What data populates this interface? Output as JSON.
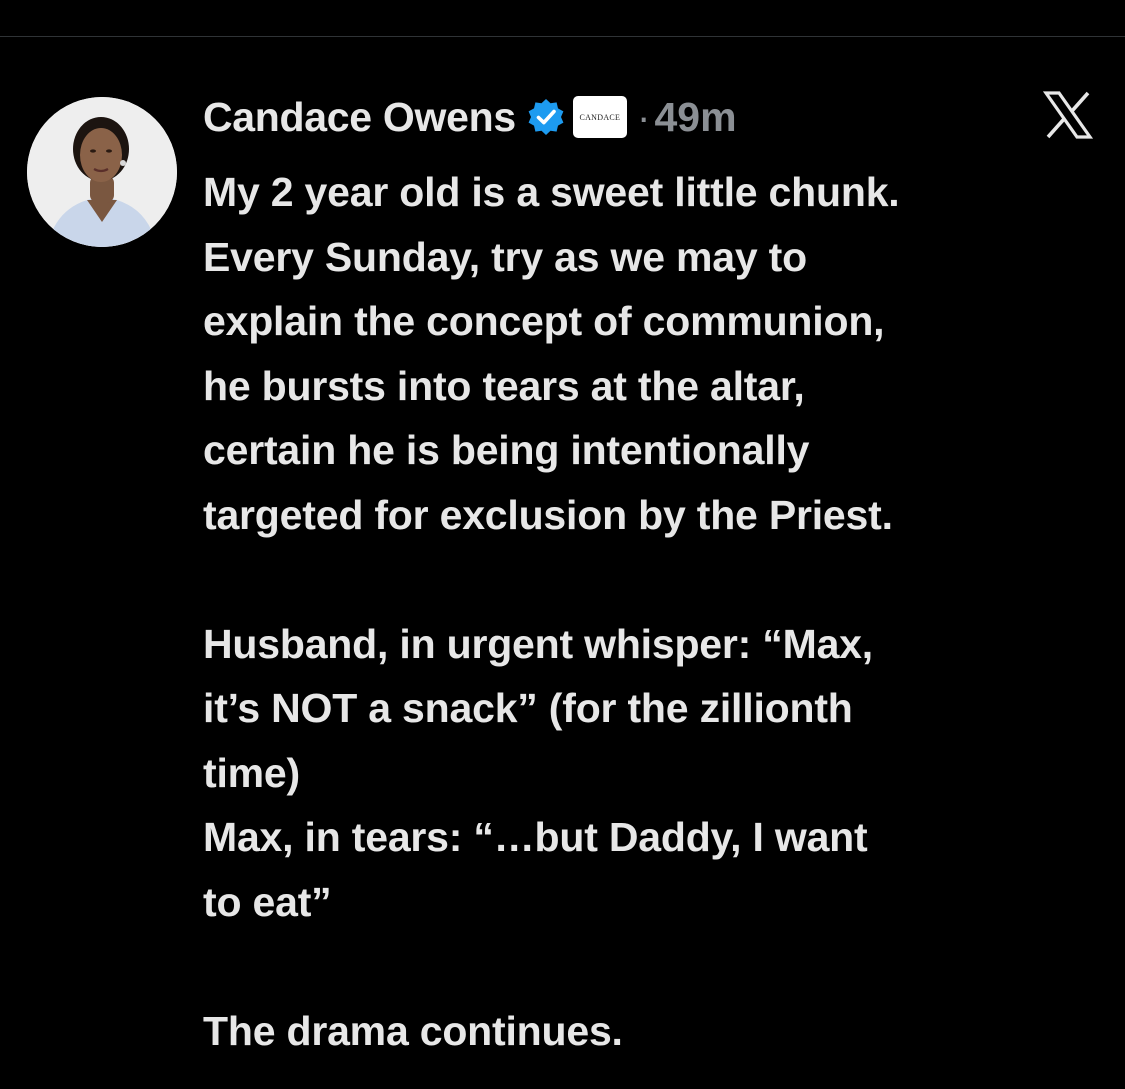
{
  "author": {
    "display_name": "Candace Owens",
    "affiliate_badge_text": "CANDACE",
    "separator": "·",
    "timestamp": "49m"
  },
  "icons": {
    "verified": "verified-badge-icon",
    "platform": "x-logo-icon"
  },
  "colors": {
    "background": "#000000",
    "text": "#e7e7e7",
    "muted": "#8b8f94",
    "verified_blue": "#1d9bf0"
  },
  "tweet": {
    "lines": [
      "My 2 year old is a sweet little chunk.",
      "Every Sunday, try as we may to",
      "explain the concept of communion,",
      "he bursts into tears at the altar,",
      "certain he is being intentionally",
      "targeted for exclusion by the Priest.",
      "",
      "Husband, in urgent whisper: “Max,",
      "it’s NOT a snack” (for the zillionth",
      "time)",
      "Max, in tears: “…but Daddy, I want",
      "to eat”",
      "",
      "The drama continues."
    ]
  }
}
